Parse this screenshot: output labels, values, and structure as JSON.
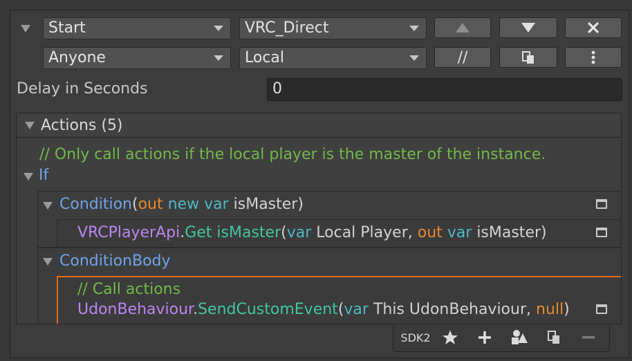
{
  "row1": {
    "event_dropdown": "Start",
    "target_dropdown": "VRC_Direct",
    "up_icon": "triangle-up-icon",
    "down_icon": "triangle-down-icon",
    "delete_icon": "close-x-icon"
  },
  "row2": {
    "broadcast_dropdown": "Anyone",
    "locality_dropdown": "Local",
    "comment_button": "//",
    "copy_icon": "copy-icon",
    "more_icon": "vertical-ellipsis-icon"
  },
  "delay": {
    "label": "Delay in Seconds",
    "value": "0"
  },
  "actions": {
    "header": "Actions (5)",
    "comment1": "// Only call actions if the local player is the master of the instance.",
    "if_keyword": "If",
    "condition": {
      "name": "Condition",
      "open": "(",
      "out": "out",
      "new": "new",
      "var": "var",
      "param": "isMaster",
      "close": ")"
    },
    "get_call": {
      "type": "VRCPlayerApi",
      "dot": ".",
      "method": "Get isMaster",
      "open": "(",
      "var1": "var",
      "arg1": "Local Player,",
      "out": "out",
      "var2": "var",
      "arg2": "isMaster",
      "close": ")"
    },
    "condition_body": "ConditionBody",
    "comment2": "// Call actions",
    "send_call": {
      "type": "UdonBehaviour",
      "dot": ".",
      "method": "SendCustomEvent",
      "open": "(",
      "var": "var",
      "arg1": "This UdonBehaviour,",
      "arg2": "null",
      "close": ")"
    }
  },
  "toolbar": {
    "sdk_label": "SDK2",
    "icons": [
      "star-icon",
      "plus-icon",
      "shapes-icon",
      "copy-icon",
      "minus-icon"
    ]
  },
  "colors": {
    "comment": "#73b84a",
    "keyword": "#6fa3e8",
    "type": "#bb86f0",
    "method": "#44c5a0",
    "out": "#e78a2c",
    "var": "#4fb8c4",
    "selection": "#e06c1a"
  }
}
